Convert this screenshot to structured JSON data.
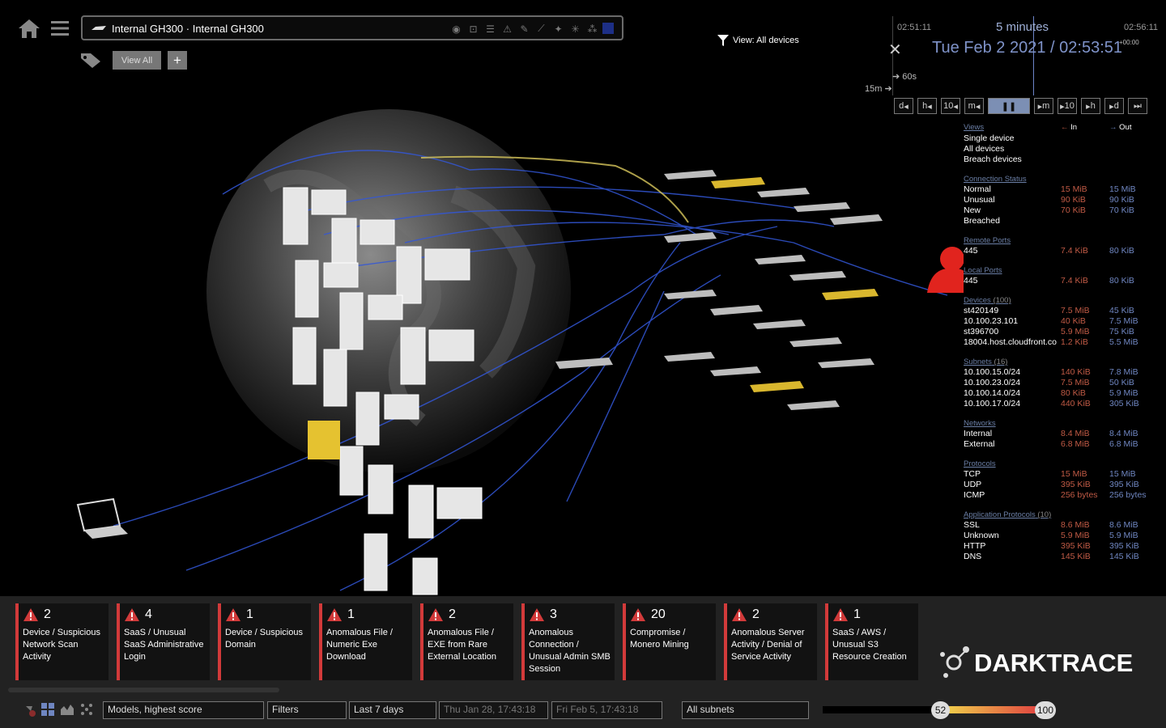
{
  "header": {
    "device_title": "Internal GH300 · Internal GH300",
    "view_all_label": "View All",
    "add_label": "+",
    "view_filter": "View: All devices"
  },
  "time": {
    "start": "02:51:11",
    "end": "02:56:11",
    "window": "5 minutes",
    "current": "Tue Feb 2 2021 / 02:53:51",
    "tz": "+00:00",
    "interval_a": "60s",
    "interval_b": "15m",
    "controls": [
      "d",
      "h",
      "10",
      "m",
      "m",
      "10",
      "h",
      "d",
      "⏭"
    ]
  },
  "panel": {
    "in_label": "In",
    "out_label": "Out",
    "views_title": "Views",
    "views": [
      "Single device",
      "All devices",
      "Breach devices"
    ],
    "sections": [
      {
        "title": "Connection Status",
        "count": "",
        "rows": [
          {
            "k": "Normal",
            "i": "15 MiB",
            "o": "15 MiB"
          },
          {
            "k": "Unusual",
            "i": "90 KiB",
            "o": "90 KiB"
          },
          {
            "k": "New",
            "i": "70 KiB",
            "o": "70 KiB"
          },
          {
            "k": "Breached",
            "i": "",
            "o": ""
          }
        ]
      },
      {
        "title": "Remote Ports",
        "count": "",
        "rows": [
          {
            "k": "445",
            "i": "7.4 KiB",
            "o": "80 KiB"
          }
        ]
      },
      {
        "title": "Local Ports",
        "count": "",
        "rows": [
          {
            "k": "445",
            "i": "7.4 KiB",
            "o": "80 KiB"
          }
        ]
      },
      {
        "title": "Devices",
        "count": "(100)",
        "rows": [
          {
            "k": "st420149",
            "i": "7.5 MiB",
            "o": "45 KiB"
          },
          {
            "k": "10.100.23.101",
            "i": "40 KiB",
            "o": "7.5 MiB"
          },
          {
            "k": "st396700",
            "i": "5.9 MiB",
            "o": "75 KiB"
          },
          {
            "k": "18004.host.cloudfront.co",
            "i": "1.2 KiB",
            "o": "5.5 MiB"
          }
        ]
      },
      {
        "title": "Subnets",
        "count": "(16)",
        "rows": [
          {
            "k": "10.100.15.0/24",
            "i": "140 KiB",
            "o": "7.8 MiB"
          },
          {
            "k": "10.100.23.0/24",
            "i": "7.5 MiB",
            "o": "50 KiB"
          },
          {
            "k": "10.100.14.0/24",
            "i": "80 KiB",
            "o": "5.9 MiB"
          },
          {
            "k": "10.100.17.0/24",
            "i": "440 KiB",
            "o": "305 KiB"
          }
        ]
      },
      {
        "title": "Networks",
        "count": "",
        "rows": [
          {
            "k": "Internal",
            "i": "8.4 MiB",
            "o": "8.4 MiB"
          },
          {
            "k": "External",
            "i": "6.8 MiB",
            "o": "6.8 MiB"
          }
        ]
      },
      {
        "title": "Protocols",
        "count": "",
        "rows": [
          {
            "k": "TCP",
            "i": "15 MiB",
            "o": "15 MiB"
          },
          {
            "k": "UDP",
            "i": "395 KiB",
            "o": "395 KiB"
          },
          {
            "k": "ICMP",
            "i": "256 bytes",
            "o": "256 bytes"
          }
        ]
      },
      {
        "title": "Application Protocols",
        "count": "(10)",
        "rows": [
          {
            "k": "SSL",
            "i": "8.6 MiB",
            "o": "8.6 MiB"
          },
          {
            "k": "Unknown",
            "i": "5.9 MiB",
            "o": "5.9 MiB"
          },
          {
            "k": "HTTP",
            "i": "395 KiB",
            "o": "395 KiB"
          },
          {
            "k": "DNS",
            "i": "145 KiB",
            "o": "145 KiB"
          }
        ]
      }
    ]
  },
  "alerts": [
    {
      "count": "2",
      "name": "Device / Suspicious Network Scan Activity"
    },
    {
      "count": "4",
      "name": "SaaS / Unusual SaaS Administrative Login"
    },
    {
      "count": "1",
      "name": "Device / Suspicious Domain"
    },
    {
      "count": "1",
      "name": "Anomalous File / Numeric Exe Download"
    },
    {
      "count": "2",
      "name": "Anomalous File / EXE from Rare External Location"
    },
    {
      "count": "3",
      "name": "Anomalous Connection / Unusual Admin SMB Session"
    },
    {
      "count": "20",
      "name": "Compromise / Monero Mining"
    },
    {
      "count": "2",
      "name": "Anomalous Server Activity / Denial of Service Activity"
    },
    {
      "count": "1",
      "name": "SaaS / AWS / Unusual S3 Resource Creation"
    }
  ],
  "bottom": {
    "sort": "Models, highest score",
    "filters": "Filters",
    "range": "Last 7 days",
    "from": "Thu Jan 28, 17:43:18",
    "to": "Fri Feb 5, 17:43:18",
    "subnets": "All subnets",
    "score_min": "52",
    "score_max": "100"
  },
  "logo_text": "DARKTRACE",
  "colors": {
    "alert": "#d23a3a",
    "in": "#c05a45",
    "out": "#6f86c1",
    "accent": "#7c8fb4"
  }
}
